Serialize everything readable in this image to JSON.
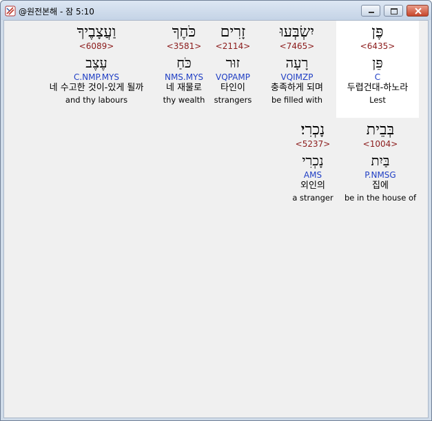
{
  "window": {
    "title": "@원전본해 - 잠 5:10"
  },
  "words": [
    {
      "hebrew": "פֶּן",
      "strong": "<6435>",
      "lemma": "פֵּן",
      "morph": "C",
      "korean": "두렵건대-하노라",
      "english": "Lest",
      "selected": true
    },
    {
      "hebrew": "יִשְׂבְּעוּ",
      "strong": "<7465>",
      "lemma": "רָעָה",
      "morph": "VQIMZP",
      "korean": "충족하게 되며",
      "english": "be filled with",
      "selected": false
    },
    {
      "hebrew": "זָרִים",
      "strong": "<2114>",
      "lemma": "זוּר",
      "morph": "VQPAMP",
      "korean": "타인이",
      "english": "strangers",
      "selected": false
    },
    {
      "hebrew": "כֹּחֶךָ",
      "strong": "<3581>",
      "lemma": "כֹּחַ",
      "morph": "NMS.MYS",
      "korean": "네 재물로",
      "english": "thy wealth",
      "selected": false
    },
    {
      "hebrew": "וַעֲצָבֶיךָ",
      "strong": "<6089>",
      "lemma": "עֶצֶב",
      "morph": "C.NMP.MYS",
      "korean": "네 수고한 것이-있게 될까",
      "english": "and thy labours",
      "selected": false
    },
    {
      "hebrew": "בְּבֵית",
      "strong": "<1004>",
      "lemma": "בַּיִת",
      "morph": "P.NMSG",
      "korean": "집에",
      "english": "be in the house of",
      "selected": false
    },
    {
      "hebrew": "נָכְרִי׃",
      "strong": "<5237>",
      "lemma": "נָכְרִי",
      "morph": "AMS",
      "korean": "외인의",
      "english": "a stranger",
      "selected": false
    }
  ]
}
